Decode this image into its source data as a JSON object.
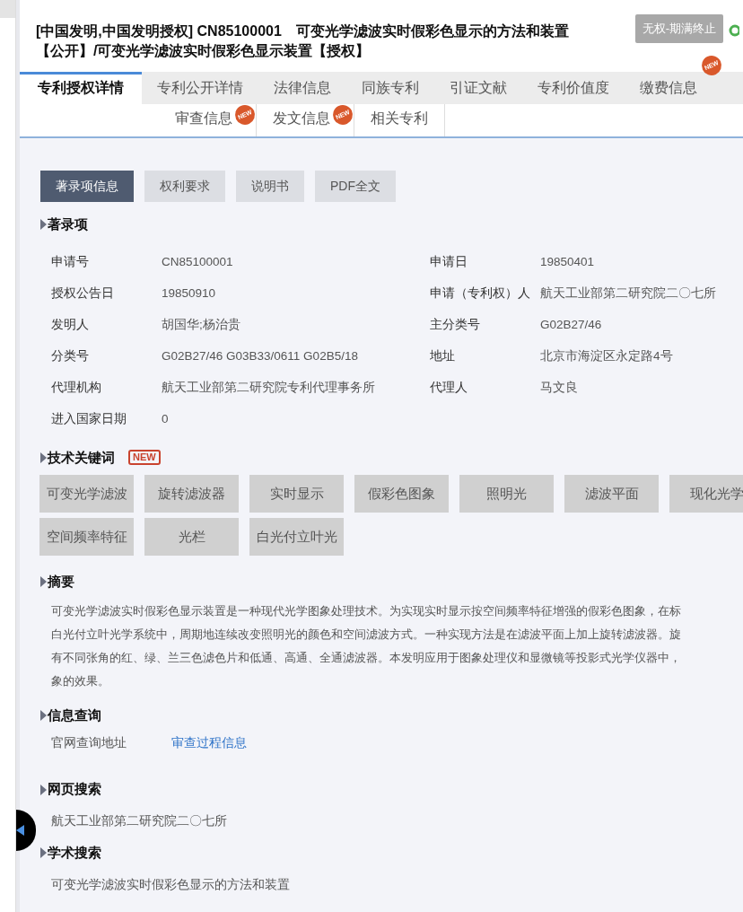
{
  "header": {
    "title_lines": [
      "[中国发明,中国发明授权] CN85100001　可变光学滤波实时假彩色显示的方法和装置",
      "【公开】/可变光学滤波实时假彩色显示装置【授权】"
    ],
    "status": "无权-期满终止"
  },
  "tabs_row1": [
    {
      "label": "专利授权详情",
      "selected": true
    },
    {
      "label": "专利公开详情",
      "selected": false
    },
    {
      "label": "法律信息",
      "selected": false
    },
    {
      "label": "同族专利",
      "selected": false
    },
    {
      "label": "引证文献",
      "selected": false
    },
    {
      "label": "专利价值度",
      "selected": false
    },
    {
      "label": "缴费信息",
      "selected": false,
      "badge": "NEW"
    }
  ],
  "tabs_row2": [
    {
      "label": "审查信息",
      "selected": false,
      "badge": "NEW"
    },
    {
      "label": "发文信息",
      "selected": false,
      "badge": "NEW"
    },
    {
      "label": "相关专利",
      "selected": false
    }
  ],
  "view_buttons": [
    {
      "label": "著录项信息",
      "selected": true
    },
    {
      "label": "权利要求",
      "selected": false
    },
    {
      "label": "说明书",
      "selected": false
    },
    {
      "label": "PDF全文",
      "selected": false
    }
  ],
  "bibliography": {
    "title": "著录项",
    "rows": [
      [
        {
          "label": "申请号",
          "value": "CN85100001"
        },
        {
          "label": "申请日",
          "value": "19850401"
        }
      ],
      [
        {
          "label": "授权公告日",
          "value": "19850910"
        },
        {
          "label": "申请（专利权）人",
          "value": "航天工业部第二研究院二〇七所"
        }
      ],
      [
        {
          "label": "发明人",
          "value": "胡国华;杨治贵"
        },
        {
          "label": "主分类号",
          "value": "G02B27/46"
        }
      ],
      [
        {
          "label": "分类号",
          "value": "G02B27/46 G03B33/0611 G02B5/18"
        },
        {
          "label": "地址",
          "value": "北京市海淀区永定路4号"
        }
      ],
      [
        {
          "label": "代理机构",
          "value": "航天工业部第二研究院专利代理事务所"
        },
        {
          "label": "代理人",
          "value": "马文良"
        }
      ],
      [
        {
          "label": "进入国家日期",
          "value": "0"
        }
      ]
    ]
  },
  "keywords": {
    "title": "技术关键词",
    "badge": "NEW",
    "tags": [
      "可变光学滤波",
      "旋转滤波器",
      "实时显示",
      "假彩色图象",
      "照明光",
      "滤波平面",
      "现化光学",
      "空间频率特征",
      "光栏",
      "白光付立叶光"
    ]
  },
  "abstract": {
    "title": "摘要",
    "lines": [
      "可变光学滤波实时假彩色显示装置是一种现代光学图象处理技术。为实现实时显示按空间频率特征增强的假彩色图象，在标",
      "白光付立叶光学系统中，周期地连续改变照明光的颜色和空间滤波方式。一种实现方法是在滤波平面上加上旋转滤波器。旋",
      "有不同张角的红、绿、兰三色滤色片和低通、高通、全通滤波器。本发明应用于图象处理仪和显微镜等投影式光学仪器中，",
      "象的效果。"
    ]
  },
  "info_query": {
    "title": "信息查询",
    "label": "官网查询地址",
    "link": "审查过程信息"
  },
  "web_search": {
    "title": "网页搜索",
    "text": "航天工业部第二研究院二〇七所"
  },
  "academic_search": {
    "title": "学术搜索",
    "text": "可变光学滤波实时假彩色显示的方法和装置"
  }
}
